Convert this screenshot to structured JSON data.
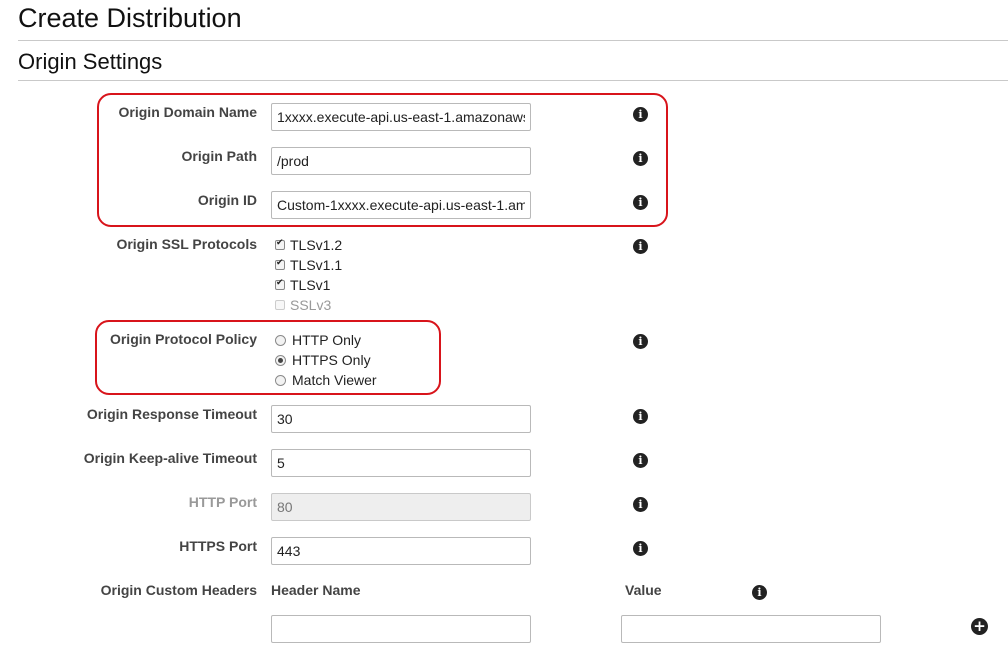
{
  "page": {
    "title": "Create Distribution"
  },
  "section": {
    "title": "Origin Settings"
  },
  "fields": {
    "origin_domain_name": {
      "label": "Origin Domain Name",
      "value": "1xxxx.execute-api.us-east-1.amazonaws"
    },
    "origin_path": {
      "label": "Origin Path",
      "value": "/prod"
    },
    "origin_id": {
      "label": "Origin ID",
      "value": "Custom-1xxxx.execute-api.us-east-1.ama"
    },
    "origin_ssl_protocols": {
      "label": "Origin SSL Protocols",
      "options": [
        {
          "label": "TLSv1.2",
          "checked": true,
          "disabled": false
        },
        {
          "label": "TLSv1.1",
          "checked": true,
          "disabled": false
        },
        {
          "label": "TLSv1",
          "checked": true,
          "disabled": false
        },
        {
          "label": "SSLv3",
          "checked": false,
          "disabled": true
        }
      ]
    },
    "origin_protocol_policy": {
      "label": "Origin Protocol Policy",
      "options": [
        {
          "label": "HTTP Only",
          "selected": false
        },
        {
          "label": "HTTPS Only",
          "selected": true
        },
        {
          "label": "Match Viewer",
          "selected": false
        }
      ]
    },
    "origin_response_timeout": {
      "label": "Origin Response Timeout",
      "value": "30"
    },
    "origin_keepalive_timeout": {
      "label": "Origin Keep-alive Timeout",
      "value": "5"
    },
    "http_port": {
      "label": "HTTP Port",
      "value": "80",
      "disabled": true
    },
    "https_port": {
      "label": "HTTPS Port",
      "value": "443"
    },
    "origin_custom_headers": {
      "label": "Origin Custom Headers",
      "header_name_col": "Header Name",
      "value_col": "Value",
      "header_name_value": "",
      "value_value": ""
    }
  },
  "icons": {
    "info": "info-icon",
    "add": "plus-circle-icon"
  },
  "colors": {
    "highlight": "#d8141b",
    "disabled_input_bg": "#eeeeee"
  }
}
